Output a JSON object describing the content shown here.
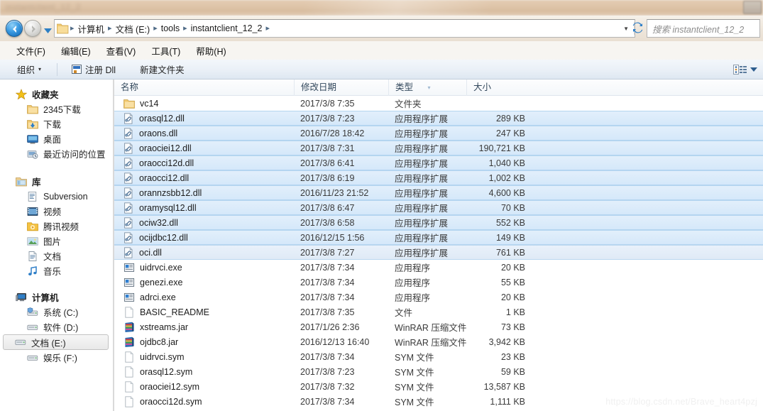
{
  "window": {
    "ghost_title": "instantclient_12_2"
  },
  "address_bar": {
    "back_icon": "back-arrow-icon",
    "forward_icon": "forward-arrow-icon",
    "history_caret": "▾",
    "folder_icon": "folder-icon",
    "breadcrumbs": [
      "计算机",
      "文档 (E:)",
      "tools",
      "instantclient_12_2"
    ],
    "separator": "▸",
    "dropdown_caret": "▼",
    "refresh_icon": "refresh-icon"
  },
  "search": {
    "placeholder": "搜索 instantclient_12_2"
  },
  "menu": {
    "items": [
      "文件(F)",
      "编辑(E)",
      "查看(V)",
      "工具(T)",
      "帮助(H)"
    ]
  },
  "toolbar": {
    "organize_label": "组织",
    "organize_caret": "▾",
    "register_dll_label": "注册 Dll",
    "new_folder_label": "新建文件夹",
    "view_caret": "▾"
  },
  "nav_pane": {
    "sections": [
      {
        "header": {
          "label": "收藏夹",
          "icon": "star-icon"
        },
        "items": [
          {
            "label": "2345下载",
            "icon": "folder-icon"
          },
          {
            "label": "下载",
            "icon": "downloads-folder-icon"
          },
          {
            "label": "桌面",
            "icon": "desktop-icon"
          },
          {
            "label": "最近访问的位置",
            "icon": "recent-places-icon"
          }
        ]
      },
      {
        "header": {
          "label": "库",
          "icon": "library-icon"
        },
        "items": [
          {
            "label": "Subversion",
            "icon": "subversion-icon"
          },
          {
            "label": "视频",
            "icon": "video-icon"
          },
          {
            "label": "腾讯视频",
            "icon": "tencent-video-icon"
          },
          {
            "label": "图片",
            "icon": "pictures-icon"
          },
          {
            "label": "文档",
            "icon": "documents-icon"
          },
          {
            "label": "音乐",
            "icon": "music-icon"
          }
        ]
      },
      {
        "header": {
          "label": "计算机",
          "icon": "computer-icon"
        },
        "items": [
          {
            "label": "系统 (C:)",
            "icon": "system-drive-icon",
            "selected": false
          },
          {
            "label": "软件 (D:)",
            "icon": "drive-icon",
            "selected": false
          },
          {
            "label": "文档 (E:)",
            "icon": "drive-icon",
            "selected": true
          },
          {
            "label": "娱乐 (F:)",
            "icon": "drive-icon",
            "selected": false
          }
        ]
      }
    ]
  },
  "file_list": {
    "columns": [
      {
        "key": "name",
        "label": "名称"
      },
      {
        "key": "date",
        "label": "修改日期"
      },
      {
        "key": "type",
        "label": "类型",
        "sorted": true,
        "sort_caret": "▾"
      },
      {
        "key": "size",
        "label": "大小"
      }
    ],
    "rows": [
      {
        "name": "vc14",
        "date": "2017/3/8 7:35",
        "type": "文件夹",
        "size": "",
        "icon": "folder-icon",
        "selected": false
      },
      {
        "name": "orasql12.dll",
        "date": "2017/3/8 7:23",
        "type": "应用程序扩展",
        "size": "289 KB",
        "icon": "dll-icon",
        "selected": true
      },
      {
        "name": "oraons.dll",
        "date": "2016/7/28 18:42",
        "type": "应用程序扩展",
        "size": "247 KB",
        "icon": "dll-icon",
        "selected": true
      },
      {
        "name": "oraociei12.dll",
        "date": "2017/3/8 7:31",
        "type": "应用程序扩展",
        "size": "190,721 KB",
        "icon": "dll-icon",
        "selected": true
      },
      {
        "name": "oraocci12d.dll",
        "date": "2017/3/8 6:41",
        "type": "应用程序扩展",
        "size": "1,040 KB",
        "icon": "dll-icon",
        "selected": true
      },
      {
        "name": "oraocci12.dll",
        "date": "2017/3/8 6:19",
        "type": "应用程序扩展",
        "size": "1,002 KB",
        "icon": "dll-icon",
        "selected": true
      },
      {
        "name": "orannzsbb12.dll",
        "date": "2016/11/23 21:52",
        "type": "应用程序扩展",
        "size": "4,600 KB",
        "icon": "dll-icon",
        "selected": true
      },
      {
        "name": "oramysql12.dll",
        "date": "2017/3/8 6:47",
        "type": "应用程序扩展",
        "size": "70 KB",
        "icon": "dll-icon",
        "selected": true
      },
      {
        "name": "ociw32.dll",
        "date": "2017/3/8 6:58",
        "type": "应用程序扩展",
        "size": "552 KB",
        "icon": "dll-icon",
        "selected": true
      },
      {
        "name": "ocijdbc12.dll",
        "date": "2016/12/15 1:56",
        "type": "应用程序扩展",
        "size": "149 KB",
        "icon": "dll-icon",
        "selected": true
      },
      {
        "name": "oci.dll",
        "date": "2017/3/8 7:27",
        "type": "应用程序扩展",
        "size": "761 KB",
        "icon": "dll-icon",
        "selected": true,
        "focus": true
      },
      {
        "name": "uidrvci.exe",
        "date": "2017/3/8 7:34",
        "type": "应用程序",
        "size": "20 KB",
        "icon": "exe-icon",
        "selected": false
      },
      {
        "name": "genezi.exe",
        "date": "2017/3/8 7:34",
        "type": "应用程序",
        "size": "55 KB",
        "icon": "exe-icon",
        "selected": false
      },
      {
        "name": "adrci.exe",
        "date": "2017/3/8 7:34",
        "type": "应用程序",
        "size": "20 KB",
        "icon": "exe-icon",
        "selected": false
      },
      {
        "name": "BASIC_README",
        "date": "2017/3/8 7:35",
        "type": "文件",
        "size": "1 KB",
        "icon": "file-icon",
        "selected": false
      },
      {
        "name": "xstreams.jar",
        "date": "2017/1/26 2:36",
        "type": "WinRAR 压缩文件",
        "size": "73 KB",
        "icon": "winrar-icon",
        "selected": false
      },
      {
        "name": "ojdbc8.jar",
        "date": "2016/12/13 16:40",
        "type": "WinRAR 压缩文件",
        "size": "3,942 KB",
        "icon": "winrar-icon",
        "selected": false
      },
      {
        "name": "uidrvci.sym",
        "date": "2017/3/8 7:34",
        "type": "SYM 文件",
        "size": "23 KB",
        "icon": "file-icon",
        "selected": false
      },
      {
        "name": "orasql12.sym",
        "date": "2017/3/8 7:23",
        "type": "SYM 文件",
        "size": "59 KB",
        "icon": "file-icon",
        "selected": false
      },
      {
        "name": "oraociei12.sym",
        "date": "2017/3/8 7:32",
        "type": "SYM 文件",
        "size": "13,587 KB",
        "icon": "file-icon",
        "selected": false
      },
      {
        "name": "oraocci12d.sym",
        "date": "2017/3/8 7:34",
        "type": "SYM 文件",
        "size": "1,111 KB",
        "icon": "file-icon",
        "selected": false
      }
    ]
  },
  "watermark": {
    "text": "https://blog.csdn.net/Brave_heart4pzj"
  },
  "colors": {
    "selection_fill": "#d5e8fa",
    "selection_border": "#b4d5f0",
    "accent": "#2f6fbd"
  }
}
